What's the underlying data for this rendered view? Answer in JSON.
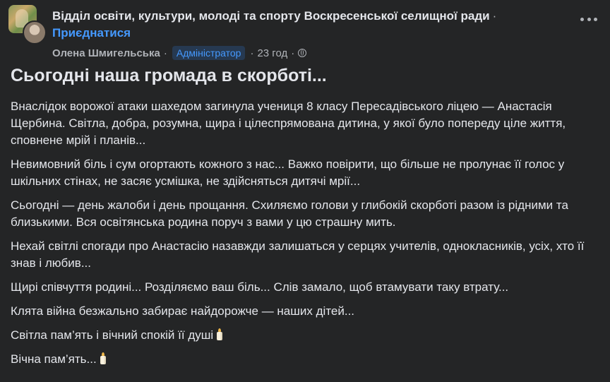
{
  "header": {
    "group_name": "Відділ освіти, культури, молоді та спорту Воскресенської селищної ради",
    "separator": "·",
    "join_label": "Приєднатися",
    "author": "Олена Шмигельська",
    "role_badge": "Адміністратор",
    "time": "23 год",
    "privacy_icon": "globe-icon",
    "more_icon": "more-options-icon"
  },
  "post": {
    "title": "Сьогодні наша громада в скорботі...",
    "paragraphs": [
      "Внаслідок ворожої атаки шахедом загинула учениця 8 класу Пересадівського ліцею — Анастасія Щербина. Світла, добра, розумна, щира і цілеспрямована дитина, у якої було попереду ціле життя, сповнене мрій і планів...",
      "Невимовний біль і сум огортають кожного з нас... Важко повірити, що більше не пролунає її голос у шкільних стінах, не засяє усмішка, не здійсняться дитячі мрії...",
      "Сьогодні — день жалоби і день прощання. Схиляємо голови у глибокій скорботі разом із рідними та близькими. Вся освітянська родина поруч з вами у цю страшну мить.",
      "Нехай світлі спогади про Анастасію назавжди залишаться у серцях учителів, однокласників, усіх, хто її знав і любив...",
      "Щирі співчуття родині... Розділяємо ваш біль... Слів замало, щоб втамувати таку втрату...",
      "Клята війна безжально забирає найдорожче — наших дітей...",
      "Світла пам’ять і вічний спокій її душі",
      "Вічна пам’ять..."
    ],
    "candle_icon": "candle-icon"
  }
}
